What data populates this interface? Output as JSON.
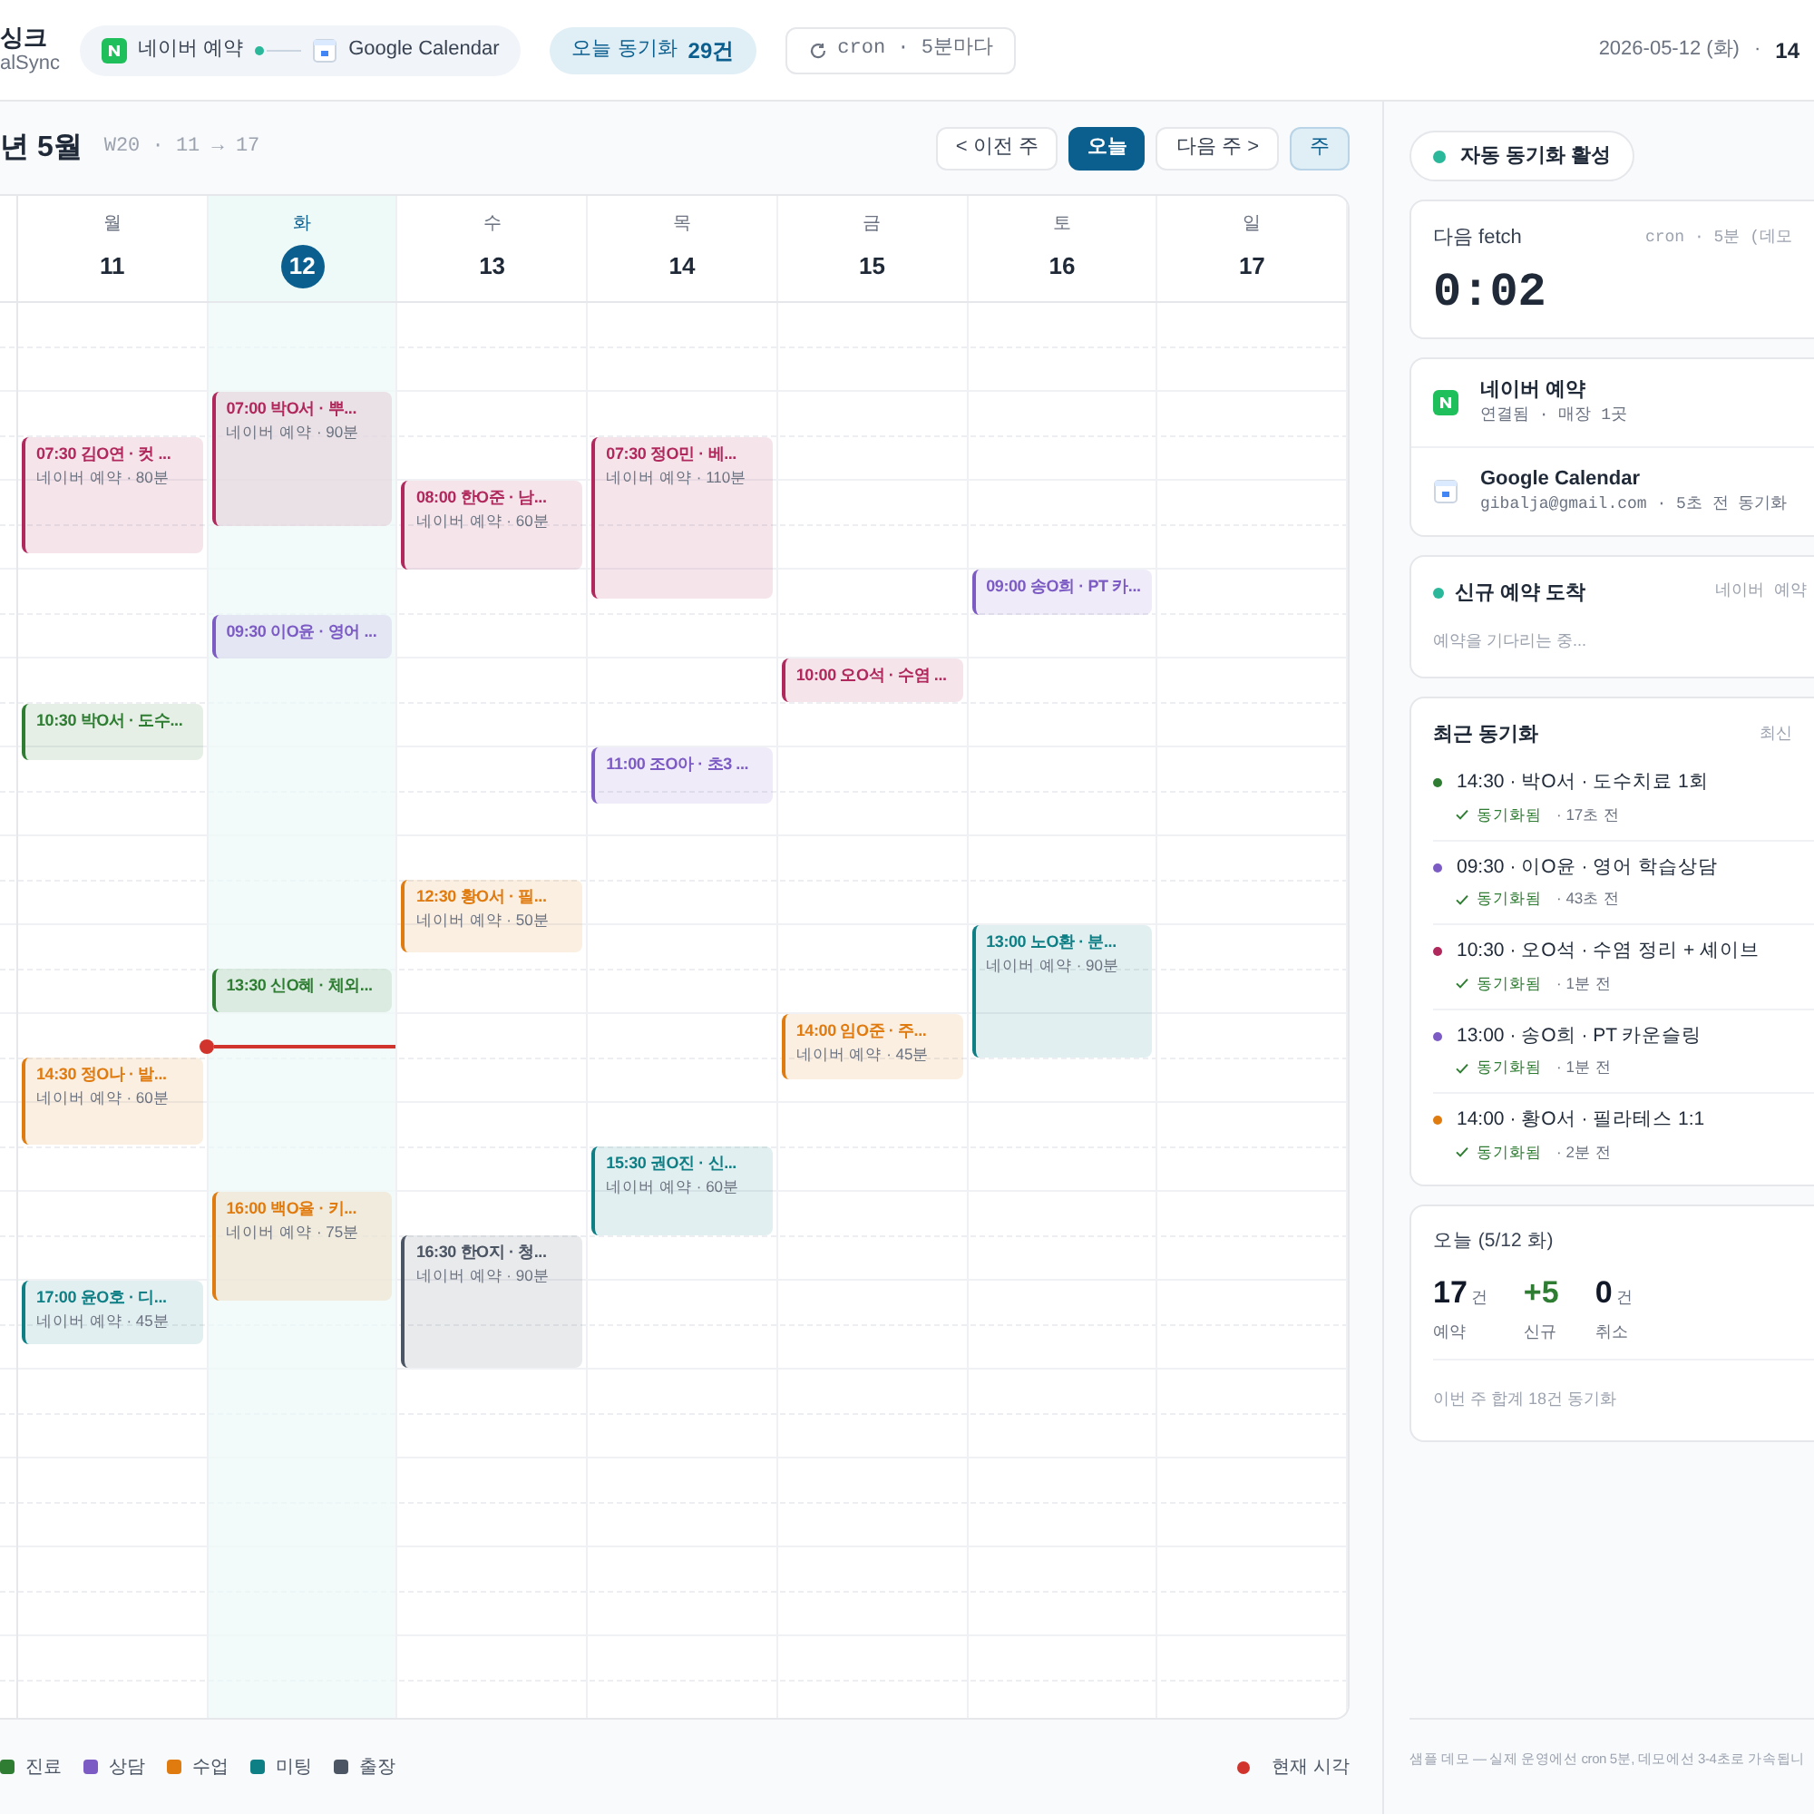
{
  "topbar": {
    "app_name": "싱크",
    "app_sub": "alSync",
    "connection": {
      "source": "네이버 예약",
      "target": "Google Calendar"
    },
    "sync_badge": {
      "label": "오늘 동기화",
      "count": "29건"
    },
    "cron_button": "cron · 5분마다",
    "date": "2026-05-12 (화)",
    "separator": "·",
    "time": "14"
  },
  "calendar": {
    "month": "년 5월",
    "week": "W20 · 11 → 17",
    "nav": [
      {
        "label": "< 이전 주",
        "kind": "plain"
      },
      {
        "label": "오늘",
        "kind": "primary"
      },
      {
        "label": "다음 주 >",
        "kind": "plain"
      }
    ],
    "views": [
      {
        "label": "주",
        "selected": true
      }
    ],
    "days": [
      {
        "weekday": "월",
        "date": "11",
        "selected": false,
        "events": [
          {
            "title": "07:30 김O연 · 컷 ...",
            "sub": "네이버 예약 · 80분",
            "color": "#b0285c"
          },
          {
            "title": "10:30 박O서 · 도수...",
            "color": "#2e7d32"
          },
          {
            "title": "14:30 정O나 · 발...",
            "sub": "네이버 예약 · 60분",
            "color": "#e07b10"
          },
          {
            "title": "17:00 윤O호 · 디...",
            "sub": "네이버 예약 · 45분",
            "color": "#0f7f86"
          }
        ]
      },
      {
        "weekday": "화",
        "date": "12",
        "selected": true,
        "events": [
          {
            "title": "07:00 박O서 · 뿌...",
            "sub": "네이버 예약 · 90분",
            "color": "#b0285c"
          },
          {
            "title": "09:30 이O윤 · 영어 ...",
            "color": "#7c5cc4"
          },
          {
            "title": "13:30 신O혜 · 체외...",
            "color": "#2e7d32"
          },
          {
            "title": "16:00 백O율 · 키...",
            "sub": "네이버 예약 · 75분",
            "color": "#e07b10"
          }
        ]
      },
      {
        "weekday": "수",
        "date": "13",
        "selected": false,
        "events": [
          {
            "title": "08:00 한O준 · 남...",
            "sub": "네이버 예약 · 60분",
            "color": "#b0285c"
          },
          {
            "title": "12:30 황O서 · 필...",
            "sub": "네이버 예약 · 50분",
            "color": "#e07b10"
          },
          {
            "title": "16:30 한O지 · 청...",
            "sub": "네이버 예약 · 90분",
            "color": "#4b5563"
          }
        ]
      },
      {
        "weekday": "목",
        "date": "14",
        "selected": false,
        "events": [
          {
            "title": "07:30 정O민 · 베...",
            "sub": "네이버 예약 · 110분",
            "color": "#b0285c"
          },
          {
            "title": "11:00 조O아 · 초3 ...",
            "color": "#7c5cc4"
          },
          {
            "title": "15:30 권O진 · 신...",
            "sub": "네이버 예약 · 60분",
            "color": "#0f7f86"
          }
        ]
      },
      {
        "weekday": "금",
        "date": "15",
        "selected": false,
        "events": [
          {
            "title": "10:00 오O석 · 수염 ...",
            "color": "#b0285c"
          },
          {
            "title": "14:00 임O준 · 주...",
            "sub": "네이버 예약 · 45분",
            "color": "#e07b10"
          }
        ]
      },
      {
        "weekday": "토",
        "date": "16",
        "selected": false,
        "events": [
          {
            "title": "09:00 송O희 · PT 카...",
            "color": "#7c5cc4"
          },
          {
            "title": "13:00 노O환 · 분...",
            "sub": "네이버 예약 · 90분",
            "color": "#0f7f86"
          }
        ]
      },
      {
        "weekday": "일",
        "date": "17",
        "selected": false
      }
    ],
    "legend": [
      {
        "label": "진료",
        "color": "#2e7d32"
      },
      {
        "label": "상담",
        "color": "#7c5cc4"
      },
      {
        "label": "수업",
        "color": "#e07b10"
      },
      {
        "label": "미팅",
        "color": "#0f7f86"
      },
      {
        "label": "출장",
        "color": "#4b5563"
      }
    ],
    "now_label": "현재 시각"
  },
  "panel": {
    "status": "자동 동기화 활성",
    "fetch": {
      "label": "다음 fetch",
      "schedule": "cron · 5분 (데모",
      "countdown": "0:02"
    },
    "connections": [
      {
        "kind": "naver",
        "name": "네이버 예약",
        "detail": "연결됨 · 매장 1곳"
      },
      {
        "kind": "google",
        "name": "Google Calendar",
        "detail": "gibalja@gmail.com · 5초 전 동기화"
      }
    ],
    "incoming": {
      "title": "신규 예약 도착",
      "source": "네이버 예약",
      "message": "예약을 기다리는 중..."
    },
    "recent": {
      "title": "최근 동기화",
      "sort": "최신",
      "items": [
        {
          "title": "14:30 · 박O서 · 도수치료 1회",
          "status": "동기화됨",
          "ago": "· 17초 전",
          "color": "#2e7d32"
        },
        {
          "title": "09:30 · 이O윤 · 영어 학습상담",
          "status": "동기화됨",
          "ago": "· 43초 전",
          "color": "#7c5cc4"
        },
        {
          "title": "10:30 · 오O석 · 수염 정리 + 셰이브",
          "status": "동기화됨",
          "ago": "· 1분 전",
          "color": "#b0285c"
        },
        {
          "title": "13:00 · 송O희 · PT 카운슬링",
          "status": "동기화됨",
          "ago": "· 1분 전",
          "color": "#7c5cc4"
        },
        {
          "title": "14:00 · 황O서 · 필라테스 1:1",
          "status": "동기화됨",
          "ago": "· 2분 전",
          "color": "#e07b10"
        }
      ]
    },
    "today": {
      "title": "오늘 (5/12 화)",
      "stats": [
        {
          "value": "17",
          "unit": "건",
          "label": "예약",
          "kind": "count"
        },
        {
          "value": "+5",
          "label": "신규",
          "kind": "new"
        },
        {
          "value": "0",
          "unit": "건",
          "label": "취소",
          "kind": "count"
        }
      ],
      "footer": "이번 주 합계 18건 동기화"
    },
    "note": "샘플 데모 — 실제 운영에선 cron 5분, 데모에선 3-4초로 가속됩니"
  }
}
